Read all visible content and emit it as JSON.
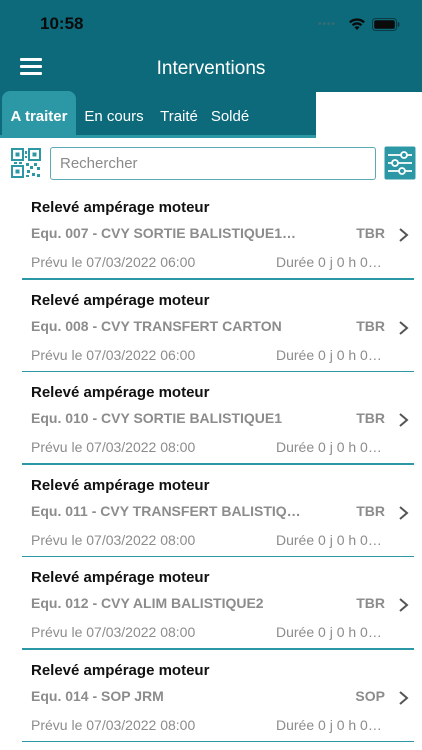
{
  "status_bar": {
    "time": "10:58"
  },
  "header": {
    "title": "Interventions"
  },
  "tabs": [
    {
      "label": "A traiter",
      "active": true
    },
    {
      "label": "En cours",
      "active": false
    },
    {
      "label": "Traité",
      "active": false
    },
    {
      "label": "Soldé",
      "active": false
    }
  ],
  "search": {
    "placeholder": "Rechercher",
    "value": ""
  },
  "icons": {
    "menu": "hamburger-menu-icon",
    "qr": "qr-code-icon",
    "filter": "sliders-filter-icon",
    "chevron": "chevron-right-icon"
  },
  "colors": {
    "primary": "#0d6a7b",
    "tab_active": "#2c98a6",
    "divider": "#2c98a6"
  },
  "interventions": [
    {
      "title": "Relevé ampérage moteur",
      "equipment": "Equ. 007 - CVY SORTIE BALISTIQUE1…",
      "code": "TBR",
      "date": "Prévu le 07/03/2022 06:00",
      "duration": "Durée 0 j 0 h 0…"
    },
    {
      "title": "Relevé ampérage moteur",
      "equipment": "Equ. 008 - CVY TRANSFERT CARTON",
      "code": "TBR",
      "date": "Prévu le 07/03/2022 06:00",
      "duration": "Durée 0 j 0 h 0…"
    },
    {
      "title": "Relevé ampérage moteur",
      "equipment": "Equ. 010 - CVY SORTIE BALISTIQUE1",
      "code": "TBR",
      "date": "Prévu le 07/03/2022 08:00",
      "duration": "Durée 0 j 0 h 0…"
    },
    {
      "title": "Relevé ampérage moteur",
      "equipment": "Equ. 011 - CVY TRANSFERT BALISTIQ…",
      "code": "TBR",
      "date": "Prévu le 07/03/2022 08:00",
      "duration": "Durée 0 j 0 h 0…"
    },
    {
      "title": "Relevé ampérage moteur",
      "equipment": "Equ. 012 - CVY ALIM BALISTIQUE2",
      "code": "TBR",
      "date": "Prévu le 07/03/2022 08:00",
      "duration": "Durée 0 j 0 h 0…"
    },
    {
      "title": "Relevé ampérage moteur",
      "equipment": "Equ. 014 - SOP JRM",
      "code": "SOP",
      "date": "Prévu le 07/03/2022 08:00",
      "duration": "Durée 0 j 0 h 0…"
    }
  ]
}
